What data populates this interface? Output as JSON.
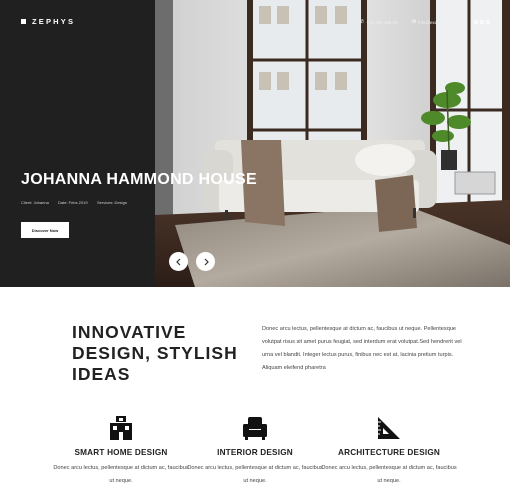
{
  "header": {
    "brand": "ZEPHYS",
    "phone": "+44 256 456 00",
    "email": "info@example.com",
    "menu_icon": "dots-menu-icon"
  },
  "hero": {
    "title": "JOHANNA HAMMOND HOUSE",
    "meta": {
      "client": "Client: Johanna",
      "date": "Date: Febs 2019",
      "services": "Services: Design"
    },
    "cta": "Discover Now",
    "prev_icon": "chevron-left-icon",
    "next_icon": "chevron-right-icon"
  },
  "intro": {
    "title_lines": [
      "INNOVATIVE",
      "DESIGN, STYLISH",
      "IDEAS"
    ],
    "text": "Donec arcu lectus, pellentesque at dictum ac, faucibus ut neque. Pellentesque volutpat risus sit amet purus feugiat, sed interdum erat volutpat.Sed hendrerit vel urna vel blandit. Integer lectus purus, finibus nec est at, lacinia pretium turpis. Aliquam eleifend pharetra"
  },
  "services": [
    {
      "icon": "house-icon",
      "title": "SMART HOME DESIGN",
      "text": "Donec arcu lectus, pellentesque at dictum ac, faucibus ut neque."
    },
    {
      "icon": "armchair-icon",
      "title": "INTERIOR DESIGN",
      "text": "Donec arcu lectus, pellentesque at dictum ac, faucibus ut neque."
    },
    {
      "icon": "set-square-icon",
      "title": "ARCHITECTURE DESIGN",
      "text": "Donec arcu lectus, pellentesque at dictum ac, faucibus ut neque."
    }
  ]
}
